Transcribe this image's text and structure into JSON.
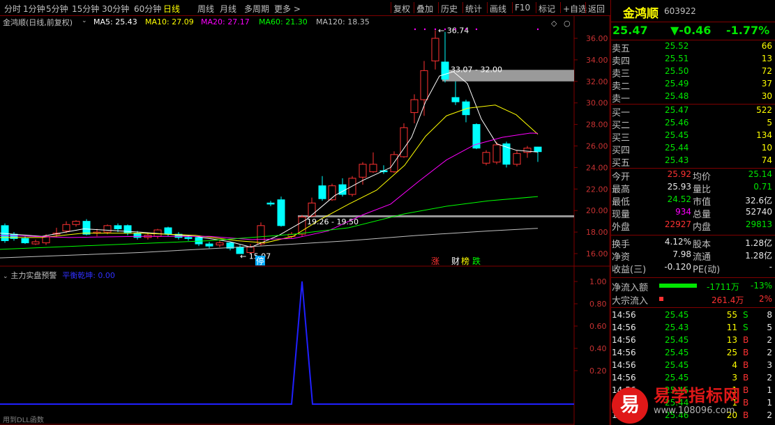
{
  "toolbar": {
    "periods": [
      "分时",
      "1分钟",
      "5分钟",
      "15分钟",
      "30分钟",
      "60分钟",
      "日线",
      "周线",
      "月线",
      "多周期",
      "更多 >"
    ],
    "active_period": "日线",
    "actions": [
      "复权",
      "叠加",
      "历史",
      "统计",
      "画线",
      "F10",
      "标记",
      "+自选",
      "返回"
    ]
  },
  "main_chart": {
    "title": "金鸿顺(日线,前复权)",
    "ma": [
      {
        "label": "MA5: 25.43",
        "color": "#ffffff"
      },
      {
        "label": "MA10: 27.09",
        "color": "#ffff00"
      },
      {
        "label": "MA20: 27.17",
        "color": "#ff00ff"
      },
      {
        "label": "MA60: 21.30",
        "color": "#00ff00"
      },
      {
        "label": "MA120: 18.35",
        "color": "#c0c0c0"
      }
    ],
    "y_ticks": [
      "36.00",
      "34.00",
      "32.00",
      "30.00",
      "28.00",
      "26.00",
      "24.00",
      "22.00",
      "20.00",
      "18.00",
      "16.00"
    ],
    "annotations": {
      "high": "36.74",
      "gap_upper": "33.07 - 32.00",
      "gap_lower": "19.26 - 19.50",
      "low": "15.97"
    },
    "tags": [
      "停",
      "涨",
      "财",
      "榜",
      "跌"
    ]
  },
  "chart_data": [
    {
      "type": "bar",
      "title": "金鸿顺(日线,前复权)",
      "ylim": [
        15,
        37
      ],
      "note": "candlestick price chart",
      "series": [
        {
          "name": "MA5",
          "values": [
            25.43
          ]
        },
        {
          "name": "MA10",
          "values": [
            27.09
          ]
        },
        {
          "name": "MA20",
          "values": [
            27.17
          ]
        },
        {
          "name": "MA60",
          "values": [
            21.3
          ]
        },
        {
          "name": "MA120",
          "values": [
            18.35
          ]
        }
      ]
    },
    {
      "type": "line",
      "title": "主力实盘预警",
      "ylim": [
        0,
        1
      ],
      "y_ticks": [
        "1.00",
        "0.80",
        "0.60",
        "0.40",
        "0.20"
      ],
      "values": [
        0,
        0,
        0,
        0,
        0,
        0,
        0,
        0,
        0,
        0,
        0,
        0,
        0,
        0,
        0,
        0,
        0,
        0,
        0,
        0,
        0,
        0,
        0,
        0,
        0,
        0,
        0,
        1,
        0,
        0,
        0,
        0,
        0,
        0,
        0,
        0,
        0,
        0,
        0,
        0,
        0,
        0,
        0,
        0,
        0,
        0,
        0,
        0,
        0,
        0,
        0,
        0
      ]
    }
  ],
  "indicator": {
    "title": "主力实盘预警",
    "sub": "平衡乾坤: 0.00",
    "footer": "用到DLL函数"
  },
  "quote": {
    "name": "金鸿顺",
    "code": "603922",
    "price": "25.47",
    "change": "▼-0.46",
    "pct": "-1.77%",
    "asks": [
      {
        "label": "卖五",
        "price": "25.52",
        "vol": "66"
      },
      {
        "label": "卖四",
        "price": "25.51",
        "vol": "13"
      },
      {
        "label": "卖三",
        "price": "25.50",
        "vol": "72"
      },
      {
        "label": "卖二",
        "price": "25.49",
        "vol": "37"
      },
      {
        "label": "卖一",
        "price": "25.48",
        "vol": "30"
      }
    ],
    "bids": [
      {
        "label": "买一",
        "price": "25.47",
        "vol": "522"
      },
      {
        "label": "买二",
        "price": "25.46",
        "vol": "5"
      },
      {
        "label": "买三",
        "price": "25.45",
        "vol": "134"
      },
      {
        "label": "买四",
        "price": "25.44",
        "vol": "10"
      },
      {
        "label": "买五",
        "price": "25.43",
        "vol": "74"
      }
    ],
    "stats": [
      {
        "l1": "今开",
        "v1": "25.92",
        "c1": "red",
        "l2": "均价",
        "v2": "25.14",
        "c2": "green"
      },
      {
        "l1": "最高",
        "v1": "25.93",
        "c1": "white",
        "l2": "量比",
        "v2": "0.71",
        "c2": "green"
      },
      {
        "l1": "最低",
        "v1": "24.52",
        "c1": "green",
        "l2": "市值",
        "v2": "32.6亿",
        "c2": "white"
      },
      {
        "l1": "现量",
        "v1": "934",
        "c1": "magenta",
        "l2": "总量",
        "v2": "52740",
        "c2": "white"
      },
      {
        "l1": "外盘",
        "v1": "22927",
        "c1": "red",
        "l2": "内盘",
        "v2": "29813",
        "c2": "green"
      }
    ],
    "stats2": [
      {
        "l1": "换手",
        "v1": "4.12%",
        "l2": "股本",
        "v2": "1.28亿"
      },
      {
        "l1": "净资",
        "v1": "7.98",
        "l2": "流通",
        "v2": "1.28亿"
      },
      {
        "l1": "收益(三)",
        "v1": "-0.120",
        "l2": "PE(动)",
        "v2": "-"
      }
    ],
    "flow": [
      {
        "label": "净流入额",
        "value": "-1711万",
        "pct": "-13%"
      },
      {
        "label": "大宗流入",
        "value": "261.4万",
        "pct": "2%"
      }
    ],
    "ticks": [
      {
        "t": "14:56",
        "p": "25.45",
        "v": "55",
        "s": "S",
        "n": "8"
      },
      {
        "t": "14:56",
        "p": "25.43",
        "v": "11",
        "s": "S",
        "n": "5"
      },
      {
        "t": "14:56",
        "p": "25.45",
        "v": "13",
        "s": "B",
        "n": "2"
      },
      {
        "t": "14:56",
        "p": "25.45",
        "v": "25",
        "s": "B",
        "n": "2"
      },
      {
        "t": "14:56",
        "p": "25.45",
        "v": "4",
        "s": "B",
        "n": "3"
      },
      {
        "t": "14:56",
        "p": "25.45",
        "v": "3",
        "s": "B",
        "n": "2"
      },
      {
        "t": "14:56",
        "p": "25.45",
        "v": "1",
        "s": "B",
        "n": "1"
      },
      {
        "t": "14:56",
        "p": "25.44",
        "v": "1",
        "s": "B",
        "n": "1"
      },
      {
        "t": "14:56",
        "p": "25.46",
        "v": "20",
        "s": "B",
        "n": "2"
      }
    ]
  },
  "watermark": {
    "logo": "易",
    "title": "易学指标网",
    "url": "www.108096.com"
  }
}
